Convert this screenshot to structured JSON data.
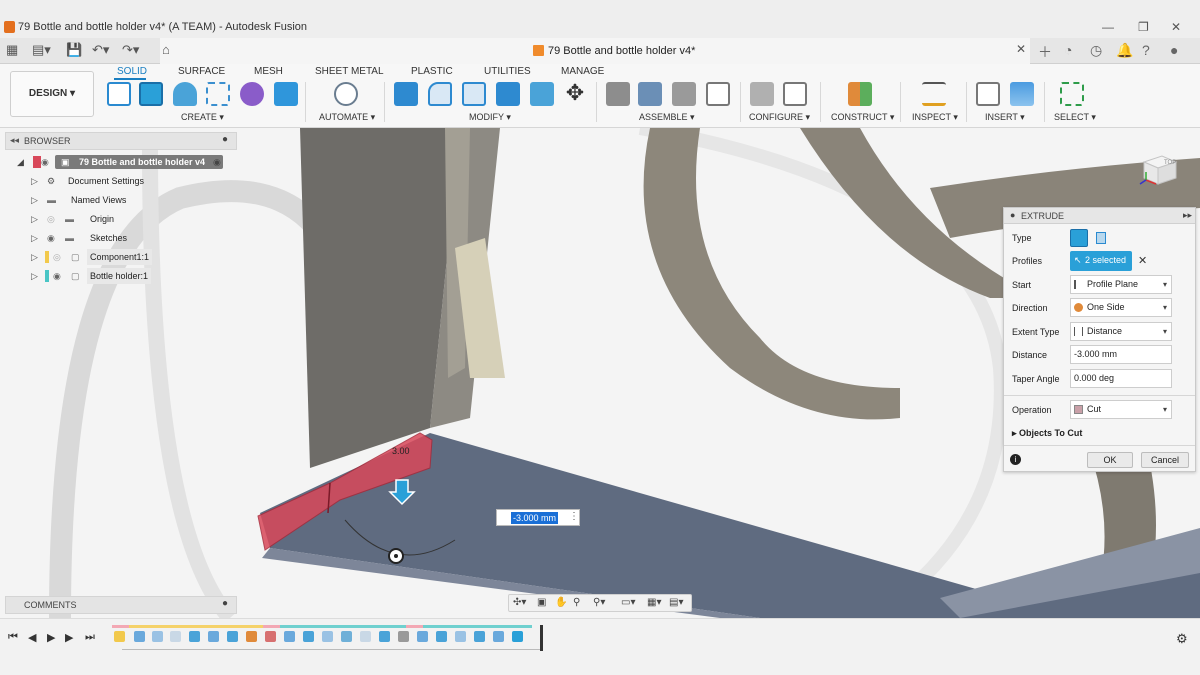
{
  "window": {
    "title": "79 Bottle and bottle holder v4* (A TEAM) - Autodesk Fusion",
    "doc_tab_title": "79 Bottle and bottle holder v4*"
  },
  "ribbon": {
    "workspace": "DESIGN ▾",
    "tabs": [
      "SOLID",
      "SURFACE",
      "MESH",
      "SHEET METAL",
      "PLASTIC",
      "UTILITIES",
      "MANAGE"
    ],
    "groups": [
      "CREATE ▾",
      "AUTOMATE ▾",
      "MODIFY ▾",
      "ASSEMBLE ▾",
      "CONFIGURE ▾",
      "CONSTRUCT ▾",
      "INSPECT ▾",
      "INSERT ▾",
      "SELECT ▾"
    ]
  },
  "browser": {
    "header": "BROWSER",
    "root": "79 Bottle and bottle holder v4",
    "items": [
      "Document Settings",
      "Named Views",
      "Origin",
      "Sketches",
      "Component1:1",
      "Bottle holder:1"
    ],
    "comments": "COMMENTS"
  },
  "extrude": {
    "title": "EXTRUDE",
    "labels": {
      "type": "Type",
      "profiles": "Profiles",
      "start": "Start",
      "direction": "Direction",
      "extent_type": "Extent Type",
      "distance": "Distance",
      "taper_angle": "Taper Angle",
      "operation": "Operation",
      "objects_to_cut": "Objects To Cut"
    },
    "values": {
      "profiles": "2 selected",
      "start": "Profile Plane",
      "direction": "One Side",
      "extent_type": "Distance",
      "distance": "-3.000 mm",
      "taper_angle": "0.000 deg",
      "operation": "Cut"
    },
    "ok": "OK",
    "cancel": "Cancel"
  },
  "viewport": {
    "dimension_input": "-3.000 mm",
    "dimension_tag": "3.00",
    "viewcube_label": "TOP"
  },
  "colors": {
    "accent": "#1a7fc1",
    "profile_selected": "#2aa0d8",
    "cut_preview": "#d8485a",
    "body_grey": "#6e6c68",
    "body_blue": "#5f6b80"
  }
}
